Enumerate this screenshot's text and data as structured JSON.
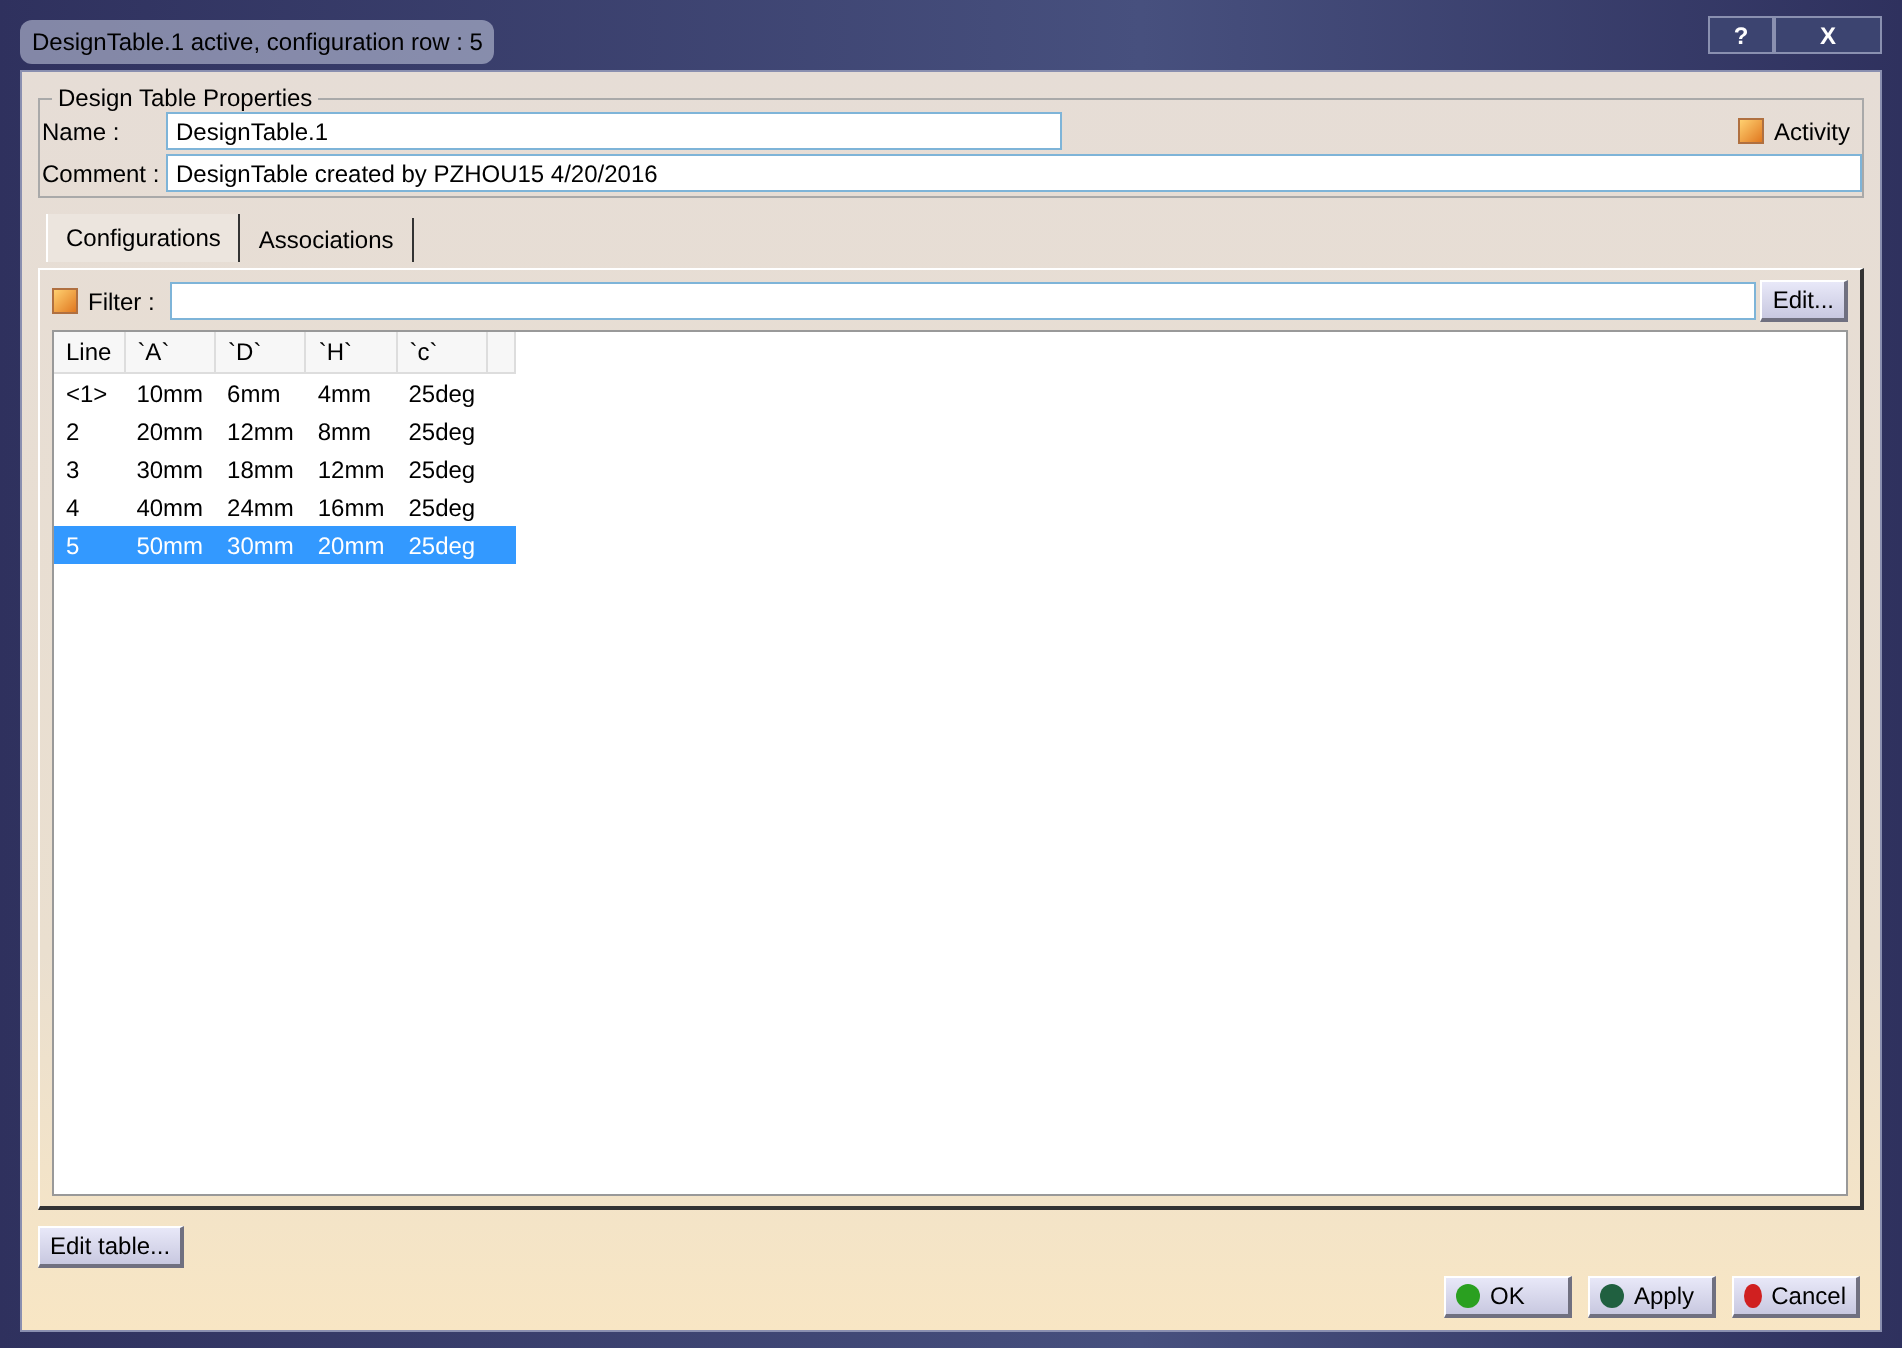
{
  "window": {
    "title": "DesignTable.1 active, configuration row : 5",
    "buttons": [
      "?",
      "X"
    ]
  },
  "properties": {
    "legend": "Design Table Properties",
    "name_label": "Name :",
    "name_value": "DesignTable.1",
    "comment_label": "Comment :",
    "comment_value": "DesignTable created by PZHOU15 4/20/2016",
    "activity": {
      "label": "Activity",
      "checked": true
    }
  },
  "tabs": [
    {
      "label": "Configurations",
      "selected": true
    },
    {
      "label": "Associations",
      "selected": false
    }
  ],
  "filter": {
    "label": "Filter :",
    "checked": true,
    "button": "Edit..."
  },
  "table": {
    "columns": [
      "Line",
      "`A`",
      "`D`",
      "`H`",
      "`c`"
    ],
    "rows": [
      {
        "cells": [
          "<1>",
          "10mm",
          "6mm",
          "4mm",
          "25deg"
        ],
        "selected": false
      },
      {
        "cells": [
          "2",
          "20mm",
          "12mm",
          "8mm",
          "25deg"
        ],
        "selected": false
      },
      {
        "cells": [
          "3",
          "30mm",
          "18mm",
          "12mm",
          "25deg"
        ],
        "selected": false
      },
      {
        "cells": [
          "4",
          "40mm",
          "24mm",
          "16mm",
          "25deg"
        ],
        "selected": false
      },
      {
        "cells": [
          "5",
          "50mm",
          "30mm",
          "20mm",
          "25deg"
        ],
        "selected": true
      }
    ]
  },
  "edit_table_button": "Edit table...",
  "footer_buttons": [
    {
      "kind": "ok",
      "label": "OK"
    },
    {
      "kind": "apply",
      "label": "Apply"
    },
    {
      "kind": "cancel",
      "label": "Cancel"
    }
  ]
}
